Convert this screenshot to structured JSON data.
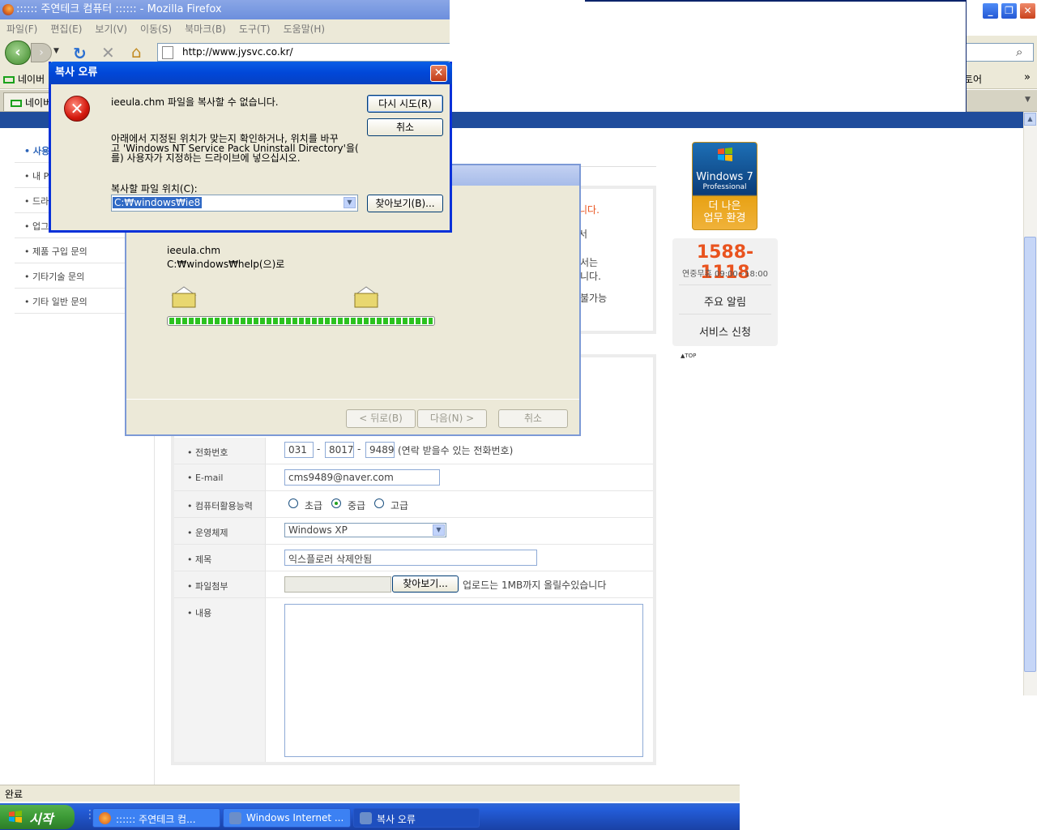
{
  "firefox": {
    "title": ":::::: 주연테크 컴퓨터 :::::: - Mozilla Firefox",
    "menu": [
      "파일(F)",
      "편집(E)",
      "보기(V)",
      "이동(S)",
      "북마크(B)",
      "도구(T)",
      "도움말(H)"
    ],
    "url": "http://www.jysvc.co.kr/",
    "bookmark_left": "네이버",
    "bookmark_right": "토어",
    "bookmark_more": "»",
    "tab_label": "네이버",
    "status": "완료"
  },
  "page": {
    "left_menu": [
      "사용",
      "내 PC",
      "드라",
      "업그",
      "제품 구입 문의",
      "기타기술 문의",
      "기타 일반 문의"
    ],
    "behind": {
      "orange_text": "니다.",
      "t2": "서",
      "t3": "서는",
      "t4": "니다.",
      "t5": "불가능"
    },
    "form": {
      "phone_label": "전화번호",
      "phone1": "031",
      "phone2": "8017",
      "phone3": "9489",
      "phone_dash": "-",
      "phone_note": "(연락 받을수 있는 전화번호)",
      "email_label": "E-mail",
      "email": "cms9489@naver.com",
      "skill_label": "컴퓨터활용능력",
      "skill_options": [
        "초급",
        "중급",
        "고급"
      ],
      "skill_selected": "중급",
      "os_label": "운영체제",
      "os_value": "Windows XP",
      "subject_label": "제목",
      "subject_value": "익스플로러 삭제안됨",
      "file_label": "파일첨부",
      "file_button": "찾아보기...",
      "file_note": "업로드는 1MB까지 올릴수있습니다",
      "content_label": "내용"
    },
    "side": {
      "win7_brand": "Windows 7",
      "win7_edition": "Professional",
      "win7_line1": "더 나은",
      "win7_line2": "업무 환경",
      "phone": "1588-1118",
      "phone_hours": "연중무휴 09:00~18:00",
      "link1": "주요 알림",
      "link2": "서비스 신청",
      "top": "▲TOP"
    }
  },
  "progress_dialog": {
    "file": "ieeula.chm",
    "dest": "C:₩windows₩help(으)로",
    "progress": 1.0,
    "back": "< 뒤로(B)",
    "next": "다음(N) >",
    "cancel": "취소"
  },
  "error_dialog": {
    "title": "복사 오류",
    "message": "ieeula.chm 파일을 복사할 수 없습니다.",
    "desc1": "아래에서 지정된 위치가 맞는지 확인하거나, 위치를 바꾸",
    "desc2": "고 'Windows NT Service Pack Uninstall Directory'을(",
    "desc3": "를) 사용자가 지정하는 드라이브에 넣으십시오.",
    "loc_label": "복사할 파일 위치(C):",
    "loc_value": "C:₩windows₩ie8",
    "retry": "다시 시도(R)",
    "cancel": "취소",
    "browse": "찾아보기(B)..."
  },
  "taskbar": {
    "start": "시작",
    "tasks": [
      ":::::: 주연테크 컴...",
      "Windows Internet ...",
      "복사 오류"
    ]
  },
  "colors": {
    "accent": "#1f4c9c",
    "phone": "#e9531e",
    "xp_blue": "#0147d8"
  }
}
